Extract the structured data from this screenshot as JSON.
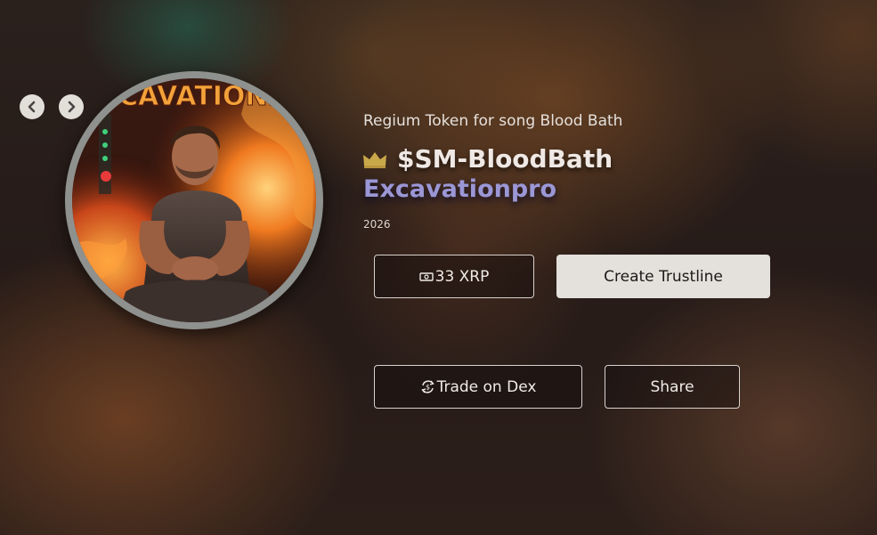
{
  "navigation": {
    "prev_icon": "chevron-left-icon",
    "next_icon": "chevron-right-icon"
  },
  "cover": {
    "banner_text": "EXCAVATIONPR",
    "ring_color": "#8e918e"
  },
  "token": {
    "subtitle": "Regium Token for song Blood Bath",
    "badge_icon": "crown-icon",
    "name": "$SM-BloodBath",
    "artist": "Excavationpro",
    "year": "2026"
  },
  "actions": {
    "price": {
      "icon": "cash-icon",
      "label": "33 XRP"
    },
    "trustline": {
      "label": "Create Trustline"
    },
    "trade": {
      "icon": "exchange-icon",
      "label": "Trade on Dex"
    },
    "share": {
      "label": "Share"
    }
  },
  "colors": {
    "artist": "#9b97d6",
    "crown": "#c9a84a",
    "primary_button": "#e4e0dc"
  }
}
